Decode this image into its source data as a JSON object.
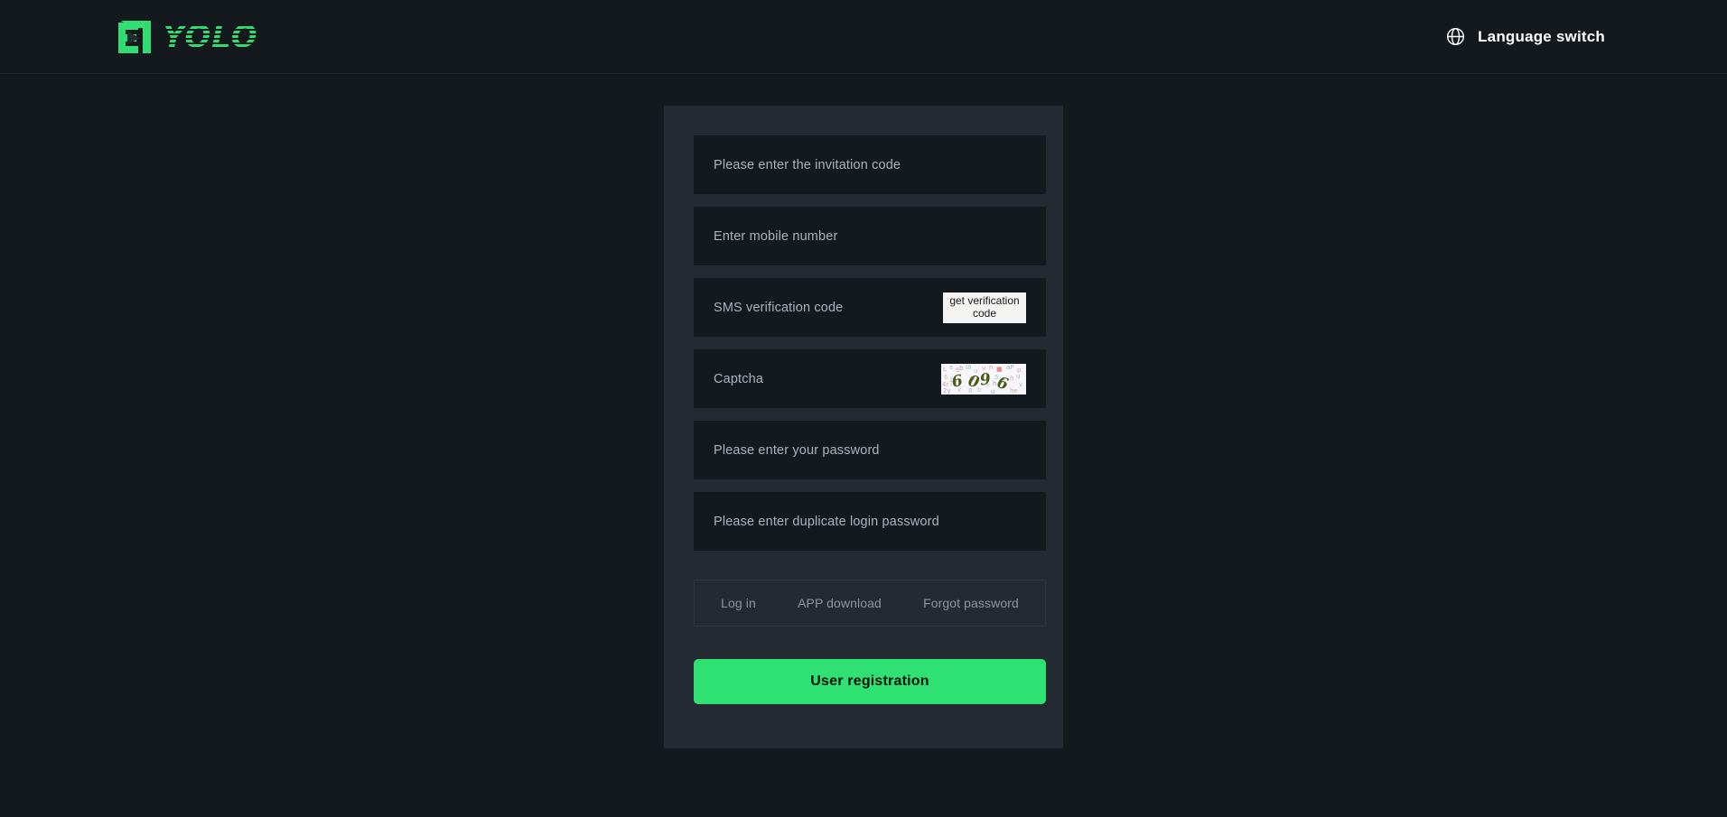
{
  "header": {
    "logo": {
      "mark_icon": "yolo-monogram-icon",
      "wordmark": "YOLO",
      "color": "#2fdd72"
    },
    "language_switch": {
      "icon": "globe-icon",
      "label": "Language switch"
    }
  },
  "form": {
    "fields": [
      {
        "name": "invitation-code",
        "placeholder": "Please enter the invitation code"
      },
      {
        "name": "mobile-number",
        "placeholder": "Enter mobile number"
      },
      {
        "name": "sms-verification-code",
        "placeholder": "SMS verification code"
      },
      {
        "name": "captcha",
        "placeholder": "Captcha"
      },
      {
        "name": "password",
        "placeholder": "Please enter your password"
      },
      {
        "name": "confirm-password",
        "placeholder": "Please enter duplicate login password"
      }
    ],
    "get_code_button": "get verification code",
    "captcha": {
      "code": "6096",
      "digit_color": "#4a5a17",
      "background": "#f7f7fb"
    },
    "links": [
      {
        "name": "log-in",
        "label": "Log in"
      },
      {
        "name": "app-download",
        "label": "APP download"
      },
      {
        "name": "forgot-password",
        "label": "Forgot password"
      }
    ],
    "submit_button": {
      "label": "User registration",
      "color": "#2fe073"
    }
  },
  "theme": {
    "page_background": "#14191d",
    "card_background": "#242a31",
    "field_background": "#14191d",
    "accent": "#2fe073",
    "placeholder_text": "#aab2bd",
    "link_text": "#8d95a3"
  }
}
